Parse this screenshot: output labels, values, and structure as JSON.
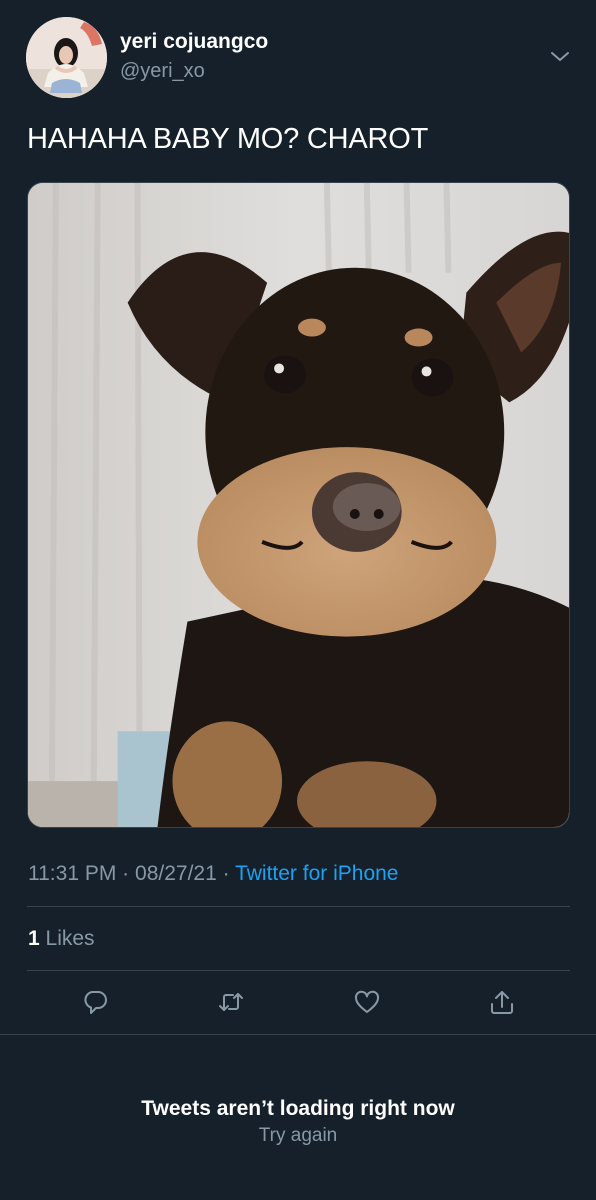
{
  "tweet": {
    "author": {
      "display_name": "yeri cojuangco",
      "handle": "@yeri_xo",
      "avatar_icon": "profile-photo"
    },
    "menu_icon": "chevron-down-icon",
    "text": "HAHAHA BABY MO? CHAROT",
    "media_icon": "photo-puppy-cheeks",
    "time": "11:31 PM",
    "date": "08/27/21",
    "separator": "·",
    "source": "Twitter for iPhone",
    "likes_count": "1",
    "likes_label": "Likes"
  },
  "actions": [
    {
      "icon": "reply-icon"
    },
    {
      "icon": "retweet-icon"
    },
    {
      "icon": "like-icon"
    },
    {
      "icon": "share-icon"
    }
  ],
  "footer": {
    "message": "Tweets aren’t loading right now",
    "retry_label": "Try again"
  },
  "colors": {
    "background": "#15202b",
    "secondary_text": "#8899a6",
    "link": "#1da1f2",
    "divider": "#38444d"
  }
}
